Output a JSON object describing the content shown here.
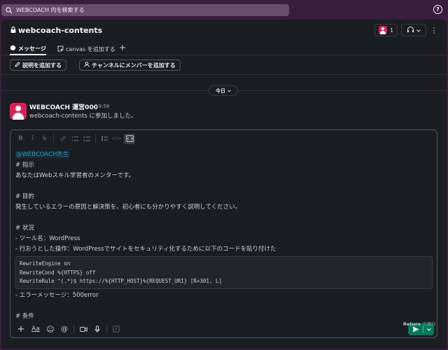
{
  "search": {
    "placeholder": "WEBCOACH 内を検索する",
    "icon": "search-icon"
  },
  "help": {
    "label": "?",
    "icon": "help-icon"
  },
  "channel": {
    "name": "webcoach-contents",
    "icon": "lock-icon"
  },
  "header": {
    "member_count": "1",
    "huddle_icon": "headphones-icon",
    "more_icon": "kebab-icon"
  },
  "tabs": [
    {
      "label": "メッセージ",
      "icon": "message-icon",
      "active": true
    },
    {
      "label": "canvas を追加する",
      "icon": "canvas-icon",
      "active": false
    }
  ],
  "tab_add": "+",
  "actions": {
    "add_description": "説明を追加する",
    "add_member": "チャンネルにメンバーを追加する"
  },
  "day_divider": {
    "label": "今日"
  },
  "message": {
    "author": "WEBCOACH 運営000",
    "time": "19:58",
    "text": "webcoach-contents に参加しました。"
  },
  "composer": {
    "mention": "@WEBCOACH先生",
    "lines": [
      "# 指示",
      "あなたはWebスキル学習者のメンターです。",
      "",
      "# 目的",
      "発生しているエラーの原因と解決策を、初心者にも分かりやすく説明してください。",
      "",
      "# 状況",
      "- ツール名：WordPress",
      "- 行おうとした操作：WordPressでサイトをセキュリティ化するために以下のコードを貼り付けた"
    ],
    "code_lines": [
      "RewriteEngine on",
      "RewriteCond %{HTTPS} off",
      "RewriteRule ^(.*)$ https://%{HTTP_HOST}%{REQUEST_URI} [R=301, L]"
    ],
    "after_lines": [
      "- エラーメッセージ：500error",
      "",
      "# 条件"
    ]
  },
  "format_toolbar": {
    "bold": "B",
    "italic": "I",
    "strike": "S",
    "link": "🔗",
    "ordered_list": "1≡",
    "bullet_list": "•≡",
    "blockquote": "❝",
    "code": "</>",
    "code_block": "⊞"
  },
  "bottom_toolbar": {
    "plus": "+",
    "text_format": "Aa",
    "emoji": "☺",
    "mention": "@",
    "video": "▭",
    "mic": "♁",
    "slash": "/"
  },
  "hint": {
    "key": "Return",
    "text": " で改行"
  },
  "colors": {
    "aubergine": "#3b1d3e",
    "background": "#1a1d21",
    "send": "#007a5a",
    "mention": "#1d9bd1",
    "avatar": "#e01e5a"
  }
}
